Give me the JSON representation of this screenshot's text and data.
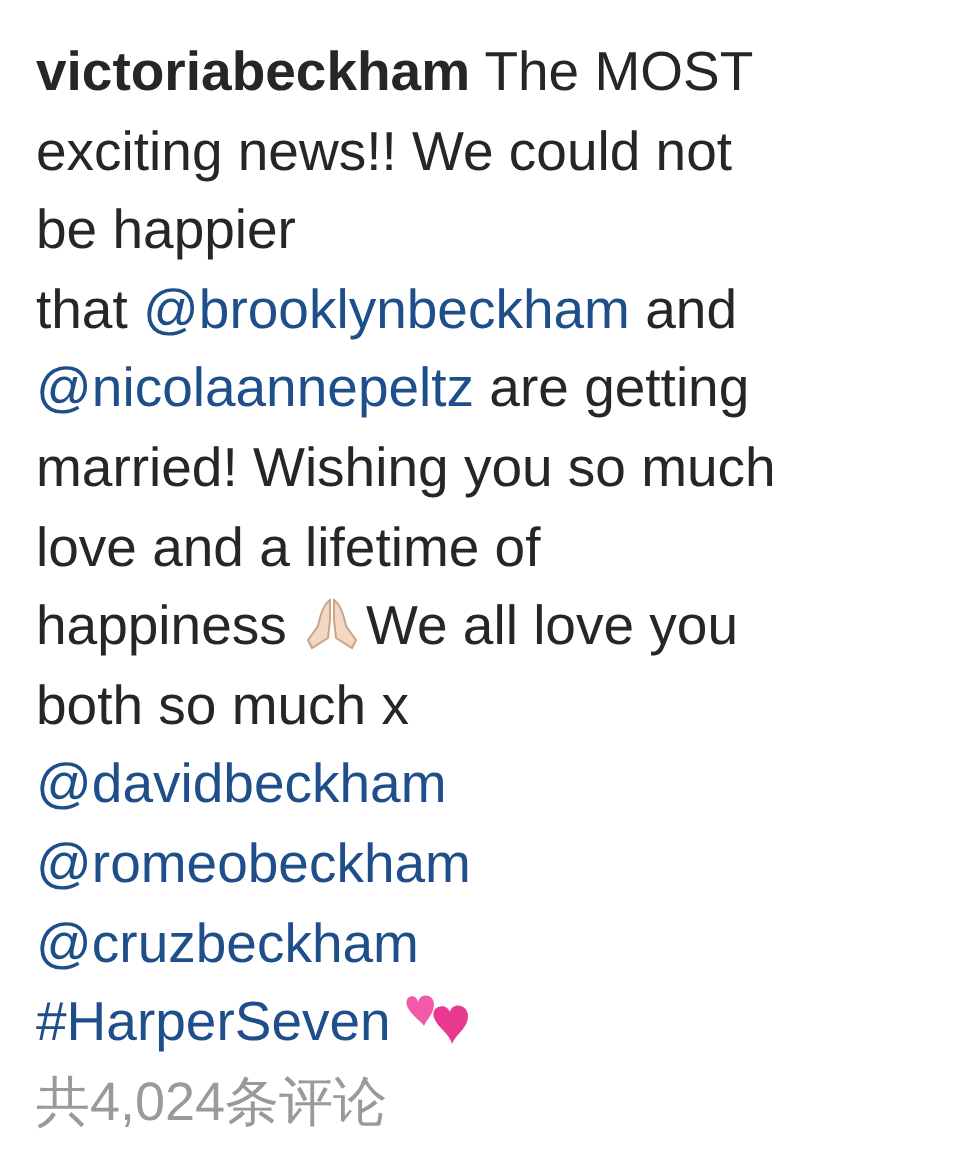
{
  "caption": {
    "lines": [
      [
        {
          "kind": "username",
          "text": "victoriabeckham"
        },
        {
          "kind": "text",
          "text": " The MOST"
        }
      ],
      [
        {
          "kind": "text",
          "text": "exciting news!! We could not"
        }
      ],
      [
        {
          "kind": "text",
          "text": "be happier"
        }
      ],
      [
        {
          "kind": "text",
          "text": "that "
        },
        {
          "kind": "mention",
          "text": "@brooklynbeckham"
        },
        {
          "kind": "text",
          "text": " and"
        }
      ],
      [
        {
          "kind": "mention",
          "text": "@nicolaannepeltz"
        },
        {
          "kind": "text",
          "text": " are getting"
        }
      ],
      [
        {
          "kind": "text",
          "text": "married! Wishing you so much"
        }
      ],
      [
        {
          "kind": "text",
          "text": "love and a lifetime of"
        }
      ],
      [
        {
          "kind": "text",
          "text": "happiness "
        },
        {
          "kind": "pray_icon"
        },
        {
          "kind": "text",
          "text": "We all love you"
        }
      ],
      [
        {
          "kind": "text",
          "text": "both so much x"
        }
      ],
      [
        {
          "kind": "mention",
          "text": "@davidbeckham"
        }
      ],
      [
        {
          "kind": "mention",
          "text": "@romeobeckham"
        }
      ],
      [
        {
          "kind": "mention",
          "text": "@cruzbeckham"
        }
      ],
      [
        {
          "kind": "mention",
          "text": "#HarperSeven"
        },
        {
          "kind": "hearts_icon"
        }
      ]
    ]
  },
  "comments_link": "共4,024条评论"
}
